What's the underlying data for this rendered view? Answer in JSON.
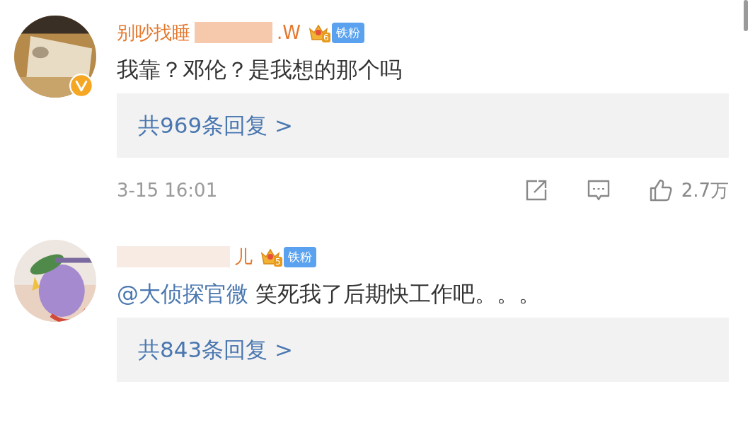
{
  "comments": [
    {
      "avatar": {
        "verified": true
      },
      "name_parts": [
        "别吵找睡",
        ".W"
      ],
      "badge": {
        "level": "6",
        "label": "铁粉"
      },
      "text": "我靠？邓伦？是我想的那个吗",
      "replies": "共969条回复 >",
      "footer": {
        "time": "3-15 16:01",
        "likes": "2.7万"
      }
    },
    {
      "avatar": {
        "verified": false
      },
      "name_parts": [
        "儿"
      ],
      "badge": {
        "level": "5",
        "label": "铁粉"
      },
      "mention": "@大侦探官微",
      "text": "笑死我了后期快工作吧。。。",
      "replies": "共843条回复 >"
    }
  ]
}
